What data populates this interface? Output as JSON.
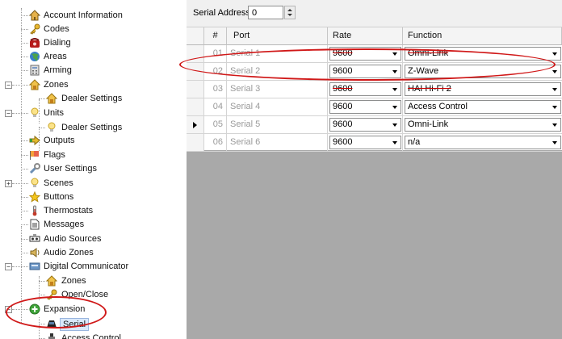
{
  "tree": {
    "items": [
      {
        "label": "Account Information",
        "icon": "house-icon"
      },
      {
        "label": "Codes",
        "icon": "key-icon"
      },
      {
        "label": "Dialing",
        "icon": "phone-icon"
      },
      {
        "label": "Areas",
        "icon": "globe-icon"
      },
      {
        "label": "Arming",
        "icon": "keypad-icon"
      },
      {
        "label": "Zones",
        "icon": "house-zone-icon"
      },
      {
        "label": "Dealer Settings",
        "icon": "house-zone-icon"
      },
      {
        "label": "Units",
        "icon": "lightbulb-icon"
      },
      {
        "label": "Dealer Settings",
        "icon": "lightbulb-icon"
      },
      {
        "label": "Outputs",
        "icon": "arrow-right-icon"
      },
      {
        "label": "Flags",
        "icon": "flag-icon"
      },
      {
        "label": "User Settings",
        "icon": "wrench-icon"
      },
      {
        "label": "Scenes",
        "icon": "lightbulb-icon"
      },
      {
        "label": "Buttons",
        "icon": "star-icon"
      },
      {
        "label": "Thermostats",
        "icon": "thermometer-icon"
      },
      {
        "label": "Messages",
        "icon": "document-icon"
      },
      {
        "label": "Audio Sources",
        "icon": "audio-source-icon"
      },
      {
        "label": "Audio Zones",
        "icon": "speaker-icon"
      },
      {
        "label": "Digital Communicator",
        "icon": "communicator-icon"
      },
      {
        "label": "Zones",
        "icon": "house-zone-icon"
      },
      {
        "label": "Open/Close",
        "icon": "key-icon"
      },
      {
        "label": "Expansion",
        "icon": "plus-circle-icon"
      },
      {
        "label": "Serial",
        "icon": "serial-icon"
      },
      {
        "label": "Access Control",
        "icon": "access-control-icon"
      }
    ]
  },
  "serial_address": {
    "label": "Serial Address:",
    "value": "0"
  },
  "grid": {
    "headers": {
      "num": "#",
      "port": "Port",
      "rate": "Rate",
      "function": "Function"
    },
    "rows": [
      {
        "num": "01",
        "port": "Serial 1",
        "rate": "9600",
        "function": "Omni-Link"
      },
      {
        "num": "02",
        "port": "Serial 2",
        "rate": "9600",
        "function": "Z-Wave"
      },
      {
        "num": "03",
        "port": "Serial 3",
        "rate": "9600",
        "function": "HAI Hi-Fi 2"
      },
      {
        "num": "04",
        "port": "Serial 4",
        "rate": "9600",
        "function": "Access Control"
      },
      {
        "num": "05",
        "port": "Serial 5",
        "rate": "9600",
        "function": "Omni-Link"
      },
      {
        "num": "06",
        "port": "Serial 6",
        "rate": "9600",
        "function": "n/a"
      }
    ],
    "current_row": "05"
  },
  "colors": {
    "annotation": "#d01818",
    "grid_background": "#a9a9a9",
    "selection": "#d9e8fb"
  }
}
